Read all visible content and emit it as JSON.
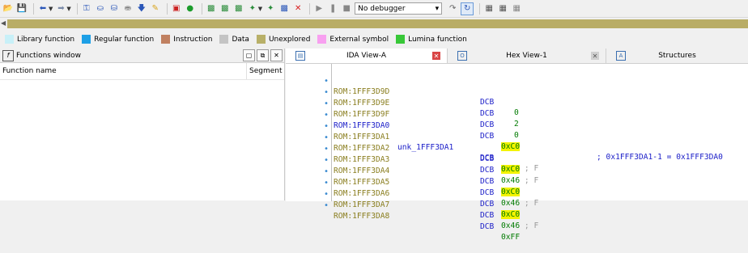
{
  "toolbar": {
    "debugger_select": "No debugger"
  },
  "legend": [
    {
      "label": "Library function",
      "color": "#c8f0f8"
    },
    {
      "label": "Regular function",
      "color": "#1ea0e6"
    },
    {
      "label": "Instruction",
      "color": "#c08060"
    },
    {
      "label": "Data",
      "color": "#c4c4c4"
    },
    {
      "label": "Unexplored",
      "color": "#b8b068"
    },
    {
      "label": "External symbol",
      "color": "#f8a0f0"
    },
    {
      "label": "Lumina function",
      "color": "#38c838"
    }
  ],
  "functions_window": {
    "title": "Functions window",
    "col_name": "Function name",
    "col_segment": "Segment"
  },
  "tabs": [
    {
      "label": "IDA View-A"
    },
    {
      "label": "Hex View-1"
    },
    {
      "label": "Structures"
    }
  ],
  "listing": [
    {
      "addr": "ROM:1FFF3D9D",
      "label": "",
      "op": "DCB",
      "val": "0",
      "kind": "num",
      "comment": ""
    },
    {
      "addr": "ROM:1FFF3D9E",
      "label": "",
      "op": "DCB",
      "val": "2",
      "kind": "num",
      "comment": ""
    },
    {
      "addr": "ROM:1FFF3D9F",
      "label": "",
      "op": "DCB",
      "val": "0",
      "kind": "num",
      "comment": ""
    },
    {
      "addr": "ROM:1FFF3DA0",
      "label": "",
      "op": "DCB",
      "val": "0xC0",
      "kind": "hl",
      "comment": "",
      "xref": "; 0x1FFF3DA1-1 = 0x1FFF3DA0"
    },
    {
      "addr": "ROM:1FFF3DA1",
      "label": "unk_1FFF3DA1",
      "op": "DCB",
      "val": "0x46",
      "kind": "hex",
      "comment": "; F"
    },
    {
      "addr": "ROM:1FFF3DA2",
      "label": "",
      "op": "DCB",
      "val": "0xC0",
      "kind": "hl",
      "comment": ""
    },
    {
      "addr": "ROM:1FFF3DA3",
      "label": "",
      "op": "DCB",
      "val": "0x46",
      "kind": "hex",
      "comment": "; F"
    },
    {
      "addr": "ROM:1FFF3DA4",
      "label": "",
      "op": "DCB",
      "val": "0xC0",
      "kind": "hl",
      "comment": ""
    },
    {
      "addr": "ROM:1FFF3DA5",
      "label": "",
      "op": "DCB",
      "val": "0x46",
      "kind": "hex",
      "comment": "; F"
    },
    {
      "addr": "ROM:1FFF3DA6",
      "label": "",
      "op": "DCB",
      "val": "0xC0",
      "kind": "hl",
      "comment": ""
    },
    {
      "addr": "ROM:1FFF3DA7",
      "label": "",
      "op": "DCB",
      "val": "0x46",
      "kind": "hex",
      "comment": "; F"
    },
    {
      "addr": "ROM:1FFF3DA8",
      "label": "",
      "op": "DCB",
      "val": "0xFF",
      "kind": "hex",
      "comment": ""
    }
  ]
}
